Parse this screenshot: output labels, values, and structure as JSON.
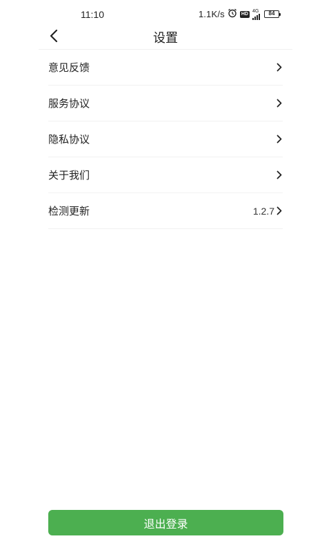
{
  "status_bar": {
    "time": "11:10",
    "network_speed": "1.1K/s",
    "icons": [
      "alarm-icon",
      "hd-icon",
      "signal-icon",
      "battery-icon"
    ],
    "hd_label": "HD",
    "network_type": "4G",
    "battery_level": "84"
  },
  "header": {
    "title": "设置",
    "back_icon": "chevron-left-icon"
  },
  "settings": {
    "items": [
      {
        "label": "意见反馈",
        "value": ""
      },
      {
        "label": "服务协议",
        "value": ""
      },
      {
        "label": "隐私协议",
        "value": ""
      },
      {
        "label": "关于我们",
        "value": ""
      },
      {
        "label": "检测更新",
        "value": "1.2.7"
      }
    ]
  },
  "footer": {
    "logout_label": "退出登录"
  },
  "colors": {
    "accent": "#4caf50",
    "text": "#222222",
    "divider": "#f1f1f1"
  }
}
